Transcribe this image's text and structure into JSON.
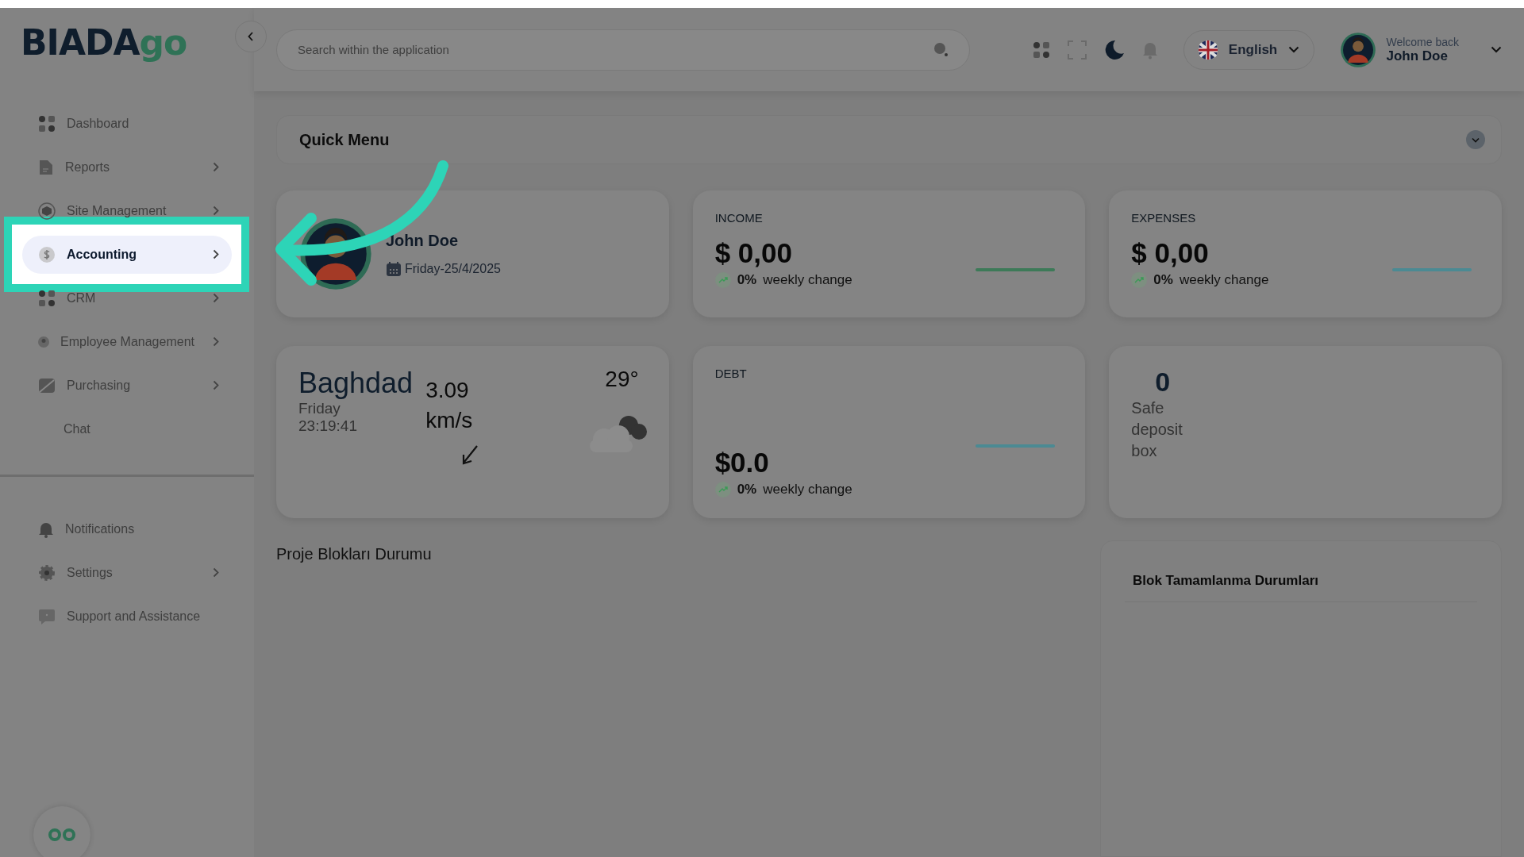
{
  "logo": {
    "text": "BIADA",
    "accent": "go"
  },
  "search": {
    "placeholder": "Search within the application"
  },
  "language": {
    "label": "English"
  },
  "user": {
    "greeting": "Welcome back",
    "name": "John Doe"
  },
  "sidebar": {
    "items": [
      {
        "label": "Dashboard",
        "expandable": false,
        "selected": false
      },
      {
        "label": "Reports",
        "expandable": true,
        "selected": false
      },
      {
        "label": "Site Management",
        "expandable": true,
        "selected": false
      },
      {
        "label": "Accounting",
        "expandable": true,
        "selected": true
      },
      {
        "label": "CRM",
        "expandable": true,
        "selected": false
      },
      {
        "label": "Employee Management",
        "expandable": true,
        "selected": false
      },
      {
        "label": "Purchasing",
        "expandable": true,
        "selected": false
      },
      {
        "label": "Chat",
        "expandable": false,
        "selected": false
      }
    ],
    "bottom_items": [
      {
        "label": "Notifications",
        "expandable": false,
        "selected": false
      },
      {
        "label": "Settings",
        "expandable": true,
        "selected": false
      },
      {
        "label": "Support and Assistance",
        "expandable": false,
        "selected": false
      }
    ]
  },
  "quick_menu": {
    "title": "Quick Menu",
    "expanded": false
  },
  "profile": {
    "name": "John Doe",
    "date": "Friday-25/4/2025"
  },
  "weather": {
    "city": "Baghdad",
    "day": "Friday",
    "time": "23:19:41",
    "wind": "3.09",
    "wind_unit": "km/s",
    "temperature": "29°"
  },
  "stats": [
    {
      "kind": "summary",
      "label": "INCOME",
      "amount": "$ 0,00",
      "change": "0%",
      "change_label": "weekly change",
      "color": "#3d7a58"
    },
    {
      "kind": "summary",
      "label": "EXPENSES",
      "amount": "$ 0,00",
      "change": "0%",
      "change_label": "weekly change",
      "color": "#4b8a93"
    },
    {
      "kind": "balance",
      "label": "DEBT",
      "amount": "$0.0",
      "change": "0%",
      "change_label": "weekly change",
      "color": "#4b8a93"
    }
  ],
  "safe_deposit": {
    "count": "0",
    "label": "Safe deposit box"
  },
  "sections": {
    "blocks_title": "Proje Blokları Durumu",
    "completion_title": "Blok Tamamlanma Durumları"
  },
  "annotation": {
    "kind": "arrow"
  }
}
